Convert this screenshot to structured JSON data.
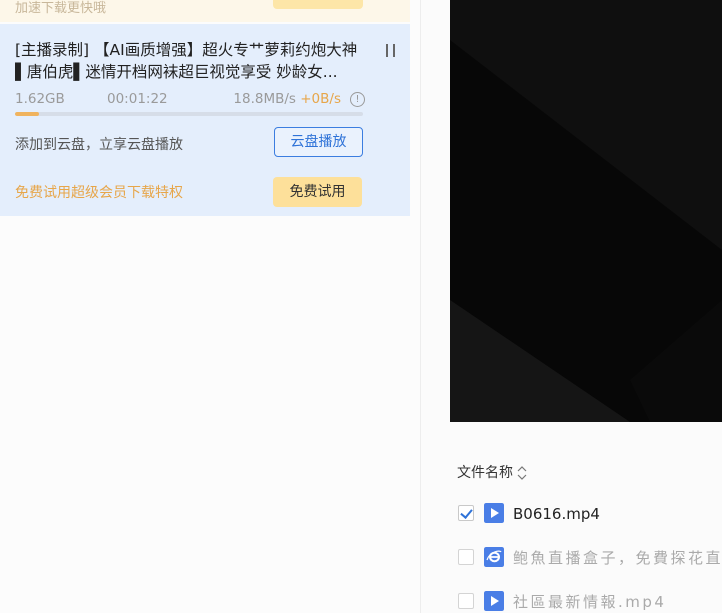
{
  "previous_task": {
    "tip": "加速下载更快哦"
  },
  "task": {
    "title": "[主播录制] 【AI画质增强】超火专艹萝莉约炮大神▌唐伯虎▌迷情开档网袜超巨视觉享受 妙龄女...",
    "size": "1.62GB",
    "elapsed": "00:01:22",
    "speed": "18.8MB/s",
    "boost_speed": "+0B/s",
    "progress": 0.07,
    "cloud_text": "添加到云盘，立享云盘播放",
    "cloud_button": "云盘播放",
    "vip_text": "免费试用超级会员下载特权",
    "vip_button": "免费试用",
    "info_glyph": "!"
  },
  "file_list": {
    "column_header": "文件名称",
    "files": [
      {
        "name": "B0616.mp4",
        "checked": true,
        "icon": "video-file-icon"
      },
      {
        "name": "鲍魚直播盒子，免費探花直",
        "checked": false,
        "icon": "ie-link-file-icon"
      },
      {
        "name": "社區最新情報.mp4",
        "checked": false,
        "icon": "video-file-icon"
      }
    ]
  },
  "colors": {
    "accent_blue": "#2f73d8",
    "card_bg": "#e4eefc",
    "vip_orange": "#e7a64a",
    "vip_button_bg": "#fde09a",
    "progress": "#f0b35e",
    "file_icon_blue": "#4a7ee6"
  }
}
